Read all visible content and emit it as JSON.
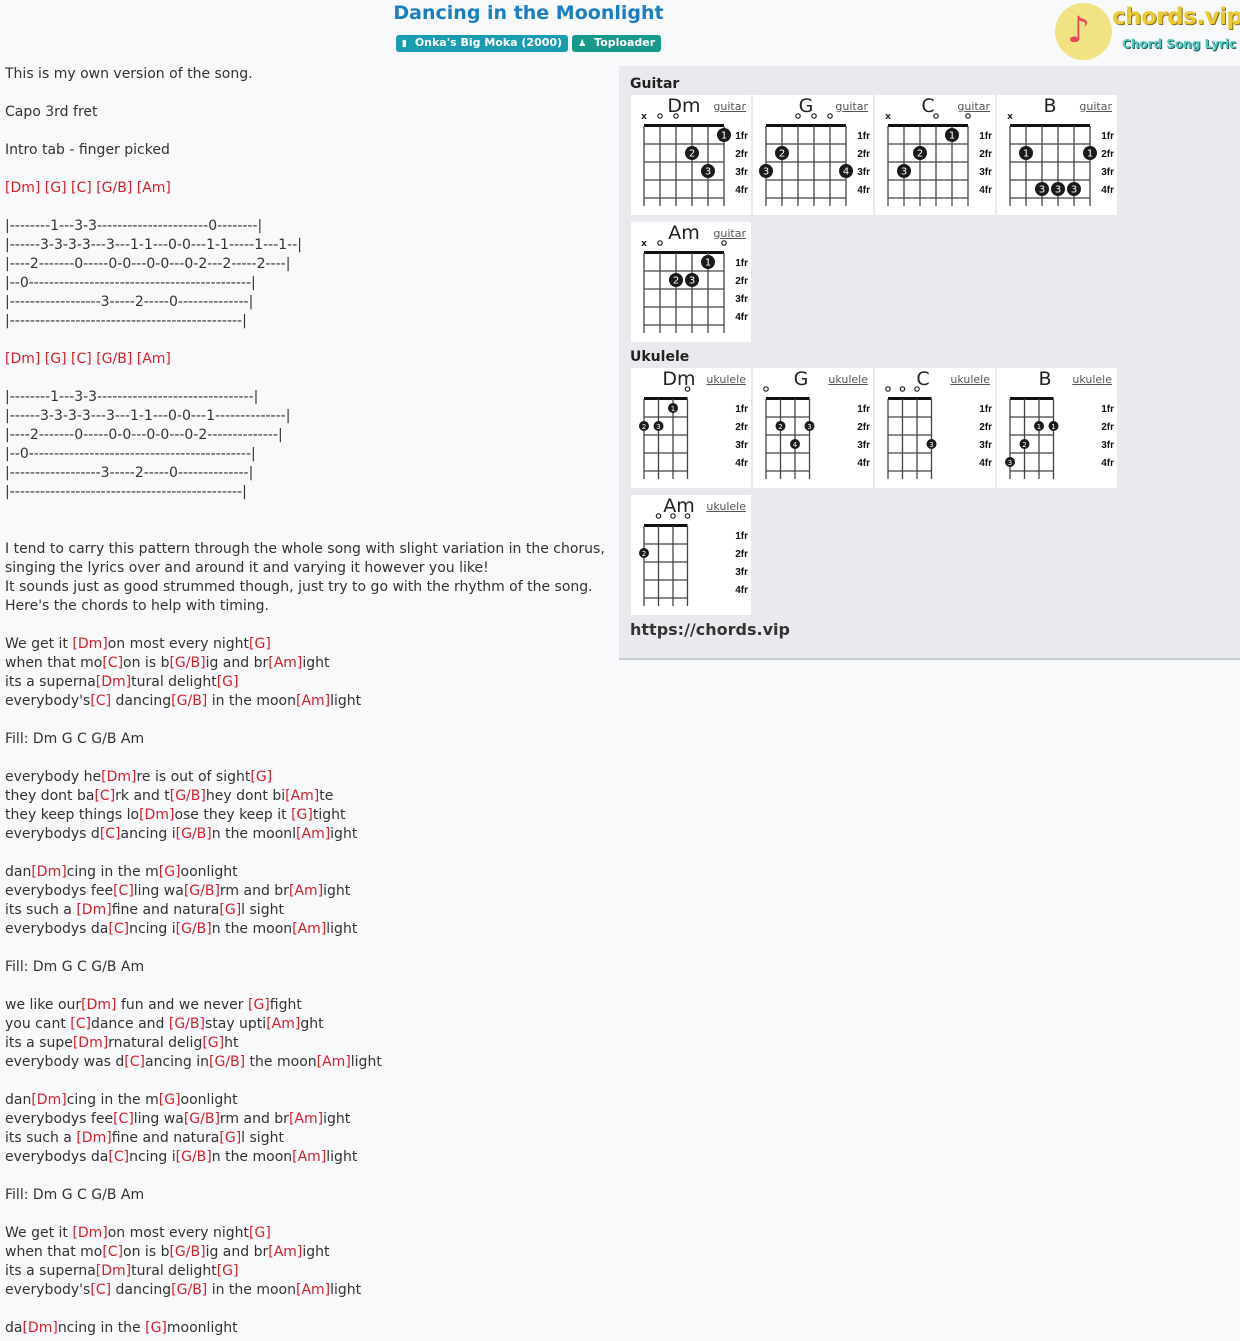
{
  "header": {
    "title": "Dancing in the Moonlight",
    "album_badge": {
      "icon": "book-icon",
      "label": "Onka's Big Moka (2000)"
    },
    "artist_badge": {
      "icon": "user-icon",
      "label": "Toploader"
    },
    "logo": {
      "name": "chords.vip",
      "subtitle": "Chord Song Lyric"
    }
  },
  "colors": {
    "title": "#1a7fc1",
    "chord": "#d3202b",
    "album_badge": "#1a9cb0",
    "artist_badge": "#16998a"
  },
  "content_lines": [
    [
      {
        "t": "This is my own version of the song."
      }
    ],
    [],
    [
      {
        "t": "Capo 3rd fret"
      }
    ],
    [],
    [
      {
        "t": "Intro tab - finger picked"
      }
    ],
    [],
    [
      {
        "c": "[Dm]"
      },
      {
        "t": " "
      },
      {
        "c": "[G]"
      },
      {
        "t": " "
      },
      {
        "c": "[C]"
      },
      {
        "t": " "
      },
      {
        "c": "[G/B]"
      },
      {
        "t": " "
      },
      {
        "c": "[Am]"
      }
    ],
    [],
    [
      {
        "t": "|--------1---3-3----------------------0--------|"
      }
    ],
    [
      {
        "t": "|------3-3-3-3---3---1-1---0-0---1-1-----1---1--|"
      }
    ],
    [
      {
        "t": "|----2-------0-----0-0---0-0---0-2---2-----2----|"
      }
    ],
    [
      {
        "t": "|--0--------------------------------------------|"
      }
    ],
    [
      {
        "t": "|------------------3-----2-----0--------------|"
      }
    ],
    [
      {
        "t": "|----------------------------------------------|"
      }
    ],
    [],
    [
      {
        "c": "[Dm]"
      },
      {
        "t": " "
      },
      {
        "c": "[G]"
      },
      {
        "t": " "
      },
      {
        "c": "[C]"
      },
      {
        "t": " "
      },
      {
        "c": "[G/B]"
      },
      {
        "t": " "
      },
      {
        "c": "[Am]"
      }
    ],
    [],
    [
      {
        "t": "|--------1---3-3-------------------------------|"
      }
    ],
    [
      {
        "t": "|------3-3-3-3---3---1-1---0-0---1--------------|"
      }
    ],
    [
      {
        "t": "|----2-------0-----0-0---0-0---0-2--------------|"
      }
    ],
    [
      {
        "t": "|--0--------------------------------------------|"
      }
    ],
    [
      {
        "t": "|------------------3-----2-----0--------------|"
      }
    ],
    [
      {
        "t": "|----------------------------------------------|"
      }
    ],
    [],
    [],
    [
      {
        "t": "I tend to carry this pattern through the whole song with slight variation in the chorus,"
      }
    ],
    [
      {
        "t": "singing the lyrics over and around it and varying it however you like!"
      }
    ],
    [
      {
        "t": "It sounds just as good strummed though, just try to go with the rhythm of the song."
      }
    ],
    [
      {
        "t": "Here's the chords to help with timing."
      }
    ],
    [],
    [
      {
        "t": "We get it "
      },
      {
        "c": "[Dm]"
      },
      {
        "t": "on most every night"
      },
      {
        "c": "[G]"
      }
    ],
    [
      {
        "t": "when that mo"
      },
      {
        "c": "[C]"
      },
      {
        "t": "on is b"
      },
      {
        "c": "[G/B]"
      },
      {
        "t": "ig and br"
      },
      {
        "c": "[Am]"
      },
      {
        "t": "ight"
      }
    ],
    [
      {
        "t": "its a superna"
      },
      {
        "c": "[Dm]"
      },
      {
        "t": "tural delight"
      },
      {
        "c": "[G]"
      }
    ],
    [
      {
        "t": "everybody's"
      },
      {
        "c": "[C]"
      },
      {
        "t": " dancing"
      },
      {
        "c": "[G/B]"
      },
      {
        "t": " in the moon"
      },
      {
        "c": "[Am]"
      },
      {
        "t": "light"
      }
    ],
    [],
    [
      {
        "t": "Fill: Dm G C G/B Am"
      }
    ],
    [],
    [
      {
        "t": "everybody he"
      },
      {
        "c": "[Dm]"
      },
      {
        "t": "re is out of sight"
      },
      {
        "c": "[G]"
      }
    ],
    [
      {
        "t": "they dont ba"
      },
      {
        "c": "[C]"
      },
      {
        "t": "rk and t"
      },
      {
        "c": "[G/B]"
      },
      {
        "t": "hey dont bi"
      },
      {
        "c": "[Am]"
      },
      {
        "t": "te"
      }
    ],
    [
      {
        "t": "they keep things lo"
      },
      {
        "c": "[Dm]"
      },
      {
        "t": "ose they keep it "
      },
      {
        "c": "[G]"
      },
      {
        "t": "tight"
      }
    ],
    [
      {
        "t": "everybodys d"
      },
      {
        "c": "[C]"
      },
      {
        "t": "ancing i"
      },
      {
        "c": "[G/B]"
      },
      {
        "t": "n the moonl"
      },
      {
        "c": "[Am]"
      },
      {
        "t": "ight"
      }
    ],
    [],
    [
      {
        "t": "dan"
      },
      {
        "c": "[Dm]"
      },
      {
        "t": "cing in the m"
      },
      {
        "c": "[G]"
      },
      {
        "t": "oonlight"
      }
    ],
    [
      {
        "t": "everybodys fee"
      },
      {
        "c": "[C]"
      },
      {
        "t": "ling wa"
      },
      {
        "c": "[G/B]"
      },
      {
        "t": "rm and br"
      },
      {
        "c": "[Am]"
      },
      {
        "t": "ight"
      }
    ],
    [
      {
        "t": "its such a "
      },
      {
        "c": "[Dm]"
      },
      {
        "t": "fine and natura"
      },
      {
        "c": "[G]"
      },
      {
        "t": "l sight"
      }
    ],
    [
      {
        "t": "everybodys da"
      },
      {
        "c": "[C]"
      },
      {
        "t": "ncing i"
      },
      {
        "c": "[G/B]"
      },
      {
        "t": "n the moon"
      },
      {
        "c": "[Am]"
      },
      {
        "t": "light"
      }
    ],
    [],
    [
      {
        "t": "Fill: Dm G C G/B Am"
      }
    ],
    [],
    [
      {
        "t": "we like our"
      },
      {
        "c": "[Dm]"
      },
      {
        "t": " fun and we never "
      },
      {
        "c": "[G]"
      },
      {
        "t": "fight"
      }
    ],
    [
      {
        "t": "you cant "
      },
      {
        "c": "[C]"
      },
      {
        "t": "dance and "
      },
      {
        "c": "[G/B]"
      },
      {
        "t": "stay upti"
      },
      {
        "c": "[Am]"
      },
      {
        "t": "ght"
      }
    ],
    [
      {
        "t": "its a supe"
      },
      {
        "c": "[Dm]"
      },
      {
        "t": "rnatural delig"
      },
      {
        "c": "[G]"
      },
      {
        "t": "ht"
      }
    ],
    [
      {
        "t": "everybody was d"
      },
      {
        "c": "[C]"
      },
      {
        "t": "ancing in"
      },
      {
        "c": "[G/B]"
      },
      {
        "t": " the moon"
      },
      {
        "c": "[Am]"
      },
      {
        "t": "light"
      }
    ],
    [],
    [
      {
        "t": "dan"
      },
      {
        "c": "[Dm]"
      },
      {
        "t": "cing in the m"
      },
      {
        "c": "[G]"
      },
      {
        "t": "oonlight"
      }
    ],
    [
      {
        "t": "everybodys fee"
      },
      {
        "c": "[C]"
      },
      {
        "t": "ling wa"
      },
      {
        "c": "[G/B]"
      },
      {
        "t": "rm and br"
      },
      {
        "c": "[Am]"
      },
      {
        "t": "ight"
      }
    ],
    [
      {
        "t": "its such a "
      },
      {
        "c": "[Dm]"
      },
      {
        "t": "fine and natura"
      },
      {
        "c": "[G]"
      },
      {
        "t": "l sight"
      }
    ],
    [
      {
        "t": "everybodys da"
      },
      {
        "c": "[C]"
      },
      {
        "t": "ncing i"
      },
      {
        "c": "[G/B]"
      },
      {
        "t": "n the moon"
      },
      {
        "c": "[Am]"
      },
      {
        "t": "light"
      }
    ],
    [],
    [
      {
        "t": "Fill: Dm G C G/B Am"
      }
    ],
    [],
    [
      {
        "t": "We get it "
      },
      {
        "c": "[Dm]"
      },
      {
        "t": "on most every night"
      },
      {
        "c": "[G]"
      }
    ],
    [
      {
        "t": "when that mo"
      },
      {
        "c": "[C]"
      },
      {
        "t": "on is b"
      },
      {
        "c": "[G/B]"
      },
      {
        "t": "ig and br"
      },
      {
        "c": "[Am]"
      },
      {
        "t": "ight"
      }
    ],
    [
      {
        "t": "its a superna"
      },
      {
        "c": "[Dm]"
      },
      {
        "t": "tural delight"
      },
      {
        "c": "[G]"
      }
    ],
    [
      {
        "t": "everybody's"
      },
      {
        "c": "[C]"
      },
      {
        "t": " dancing"
      },
      {
        "c": "[G/B]"
      },
      {
        "t": " in the moon"
      },
      {
        "c": "[Am]"
      },
      {
        "t": "light"
      }
    ],
    [],
    [
      {
        "t": "da"
      },
      {
        "c": "[Dm]"
      },
      {
        "t": "ncing in the "
      },
      {
        "c": "[G]"
      },
      {
        "t": "moonlight"
      }
    ]
  ],
  "chord_panel": {
    "guitar_label": "Guitar",
    "ukulele_label": "Ukulele",
    "fret_labels": [
      "1fr",
      "2fr",
      "3fr",
      "4fr"
    ],
    "url": "https://chords.vip",
    "guitar": [
      {
        "name": "Dm",
        "link": "guitar",
        "strings": [
          "x",
          "o",
          "o",
          "",
          "",
          ""
        ],
        "dots": [
          {
            "s": 6,
            "f": 1,
            "n": "1"
          },
          {
            "s": 4,
            "f": 2,
            "n": "2"
          },
          {
            "s": 5,
            "f": 3,
            "n": "3"
          }
        ]
      },
      {
        "name": "G",
        "link": "guitar",
        "strings": [
          "",
          "",
          "o",
          "o",
          "o",
          ""
        ],
        "dots": [
          {
            "s": 2,
            "f": 2,
            "n": "2"
          },
          {
            "s": 1,
            "f": 3,
            "n": "3"
          },
          {
            "s": 6,
            "f": 3,
            "n": "4"
          }
        ]
      },
      {
        "name": "C",
        "link": "guitar",
        "strings": [
          "x",
          "",
          "",
          "o",
          "",
          "o"
        ],
        "dots": [
          {
            "s": 5,
            "f": 1,
            "n": "1"
          },
          {
            "s": 3,
            "f": 2,
            "n": "2"
          },
          {
            "s": 2,
            "f": 3,
            "n": "3"
          }
        ]
      },
      {
        "name": "B",
        "link": "guitar",
        "strings": [
          "x",
          "",
          "",
          "",
          "",
          ""
        ],
        "dots": [
          {
            "s": 2,
            "f": 2,
            "n": "1"
          },
          {
            "s": 6,
            "f": 2,
            "n": "1"
          },
          {
            "s": 3,
            "f": 4,
            "n": "3"
          },
          {
            "s": 4,
            "f": 4,
            "n": "3"
          },
          {
            "s": 5,
            "f": 4,
            "n": "3"
          }
        ]
      },
      {
        "name": "Am",
        "link": "guitar",
        "strings": [
          "x",
          "o",
          "",
          "",
          "",
          "o"
        ],
        "dots": [
          {
            "s": 5,
            "f": 1,
            "n": "1"
          },
          {
            "s": 3,
            "f": 2,
            "n": "2"
          },
          {
            "s": 4,
            "f": 2,
            "n": "3"
          }
        ]
      }
    ],
    "ukulele": [
      {
        "name": "Dm",
        "link": "ukulele",
        "strings": [
          "",
          "",
          "",
          "o"
        ],
        "dots": [
          {
            "s": 3,
            "f": 1,
            "n": "1"
          },
          {
            "s": 1,
            "f": 2,
            "n": "2"
          },
          {
            "s": 2,
            "f": 2,
            "n": "3"
          }
        ]
      },
      {
        "name": "G",
        "link": "ukulele",
        "strings": [
          "o",
          "",
          "",
          ""
        ],
        "dots": [
          {
            "s": 2,
            "f": 2,
            "n": "2"
          },
          {
            "s": 4,
            "f": 2,
            "n": "3"
          },
          {
            "s": 3,
            "f": 3,
            "n": "4"
          }
        ]
      },
      {
        "name": "C",
        "link": "ukulele",
        "strings": [
          "o",
          "o",
          "o",
          ""
        ],
        "dots": [
          {
            "s": 4,
            "f": 3,
            "n": "3"
          }
        ]
      },
      {
        "name": "B",
        "link": "ukulele",
        "strings": [
          "",
          "",
          "",
          ""
        ],
        "dots": [
          {
            "s": 3,
            "f": 2,
            "n": "1"
          },
          {
            "s": 4,
            "f": 2,
            "n": "1"
          },
          {
            "s": 2,
            "f": 3,
            "n": "2"
          },
          {
            "s": 1,
            "f": 4,
            "n": "3"
          }
        ]
      },
      {
        "name": "Am",
        "link": "ukulele",
        "strings": [
          "",
          "o",
          "o",
          "o"
        ],
        "dots": [
          {
            "s": 1,
            "f": 2,
            "n": "2"
          }
        ]
      }
    ]
  }
}
